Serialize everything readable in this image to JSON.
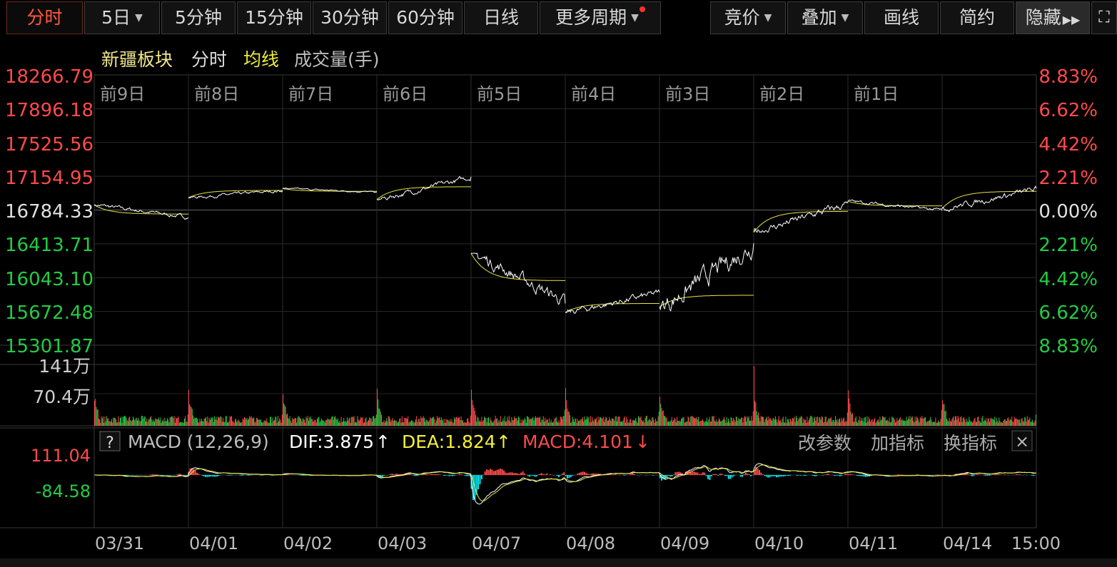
{
  "toolbar": {
    "tabs": [
      "分时",
      "5日",
      "5分钟",
      "15分钟",
      "30分钟",
      "60分钟",
      "日线",
      "更多周期"
    ],
    "tools": [
      "竞价",
      "叠加",
      "画线",
      "简约",
      "隐藏"
    ],
    "active_tab": "分时"
  },
  "legend": {
    "name": "新疆板块",
    "mode": "分时",
    "avg": "均线",
    "volume": "成交量(手)"
  },
  "price_axis": {
    "left": [
      "18266.79",
      "17896.18",
      "17525.56",
      "17154.95",
      "16784.33",
      "16413.71",
      "16043.10",
      "15672.48",
      "15301.87"
    ],
    "right": [
      "8.83%",
      "6.62%",
      "4.42%",
      "2.21%",
      "0.00%",
      "2.21%",
      "4.42%",
      "6.62%",
      "8.83%"
    ]
  },
  "day_labels": [
    "前9日",
    "前8日",
    "前7日",
    "前6日",
    "前5日",
    "前4日",
    "前3日",
    "前2日",
    "前1日"
  ],
  "volume_axis": [
    "141万",
    "70.4万"
  ],
  "macd": {
    "help": "?",
    "title": "MACD (12,26,9)",
    "dif": "DIF:3.875",
    "dif_arrow": "↑",
    "dea": "DEA:1.824",
    "dea_arrow": "↑",
    "macd": "MACD:4.101",
    "macd_arrow": "↓",
    "axis": [
      "111.04",
      "-84.58"
    ],
    "buttons": [
      "改参数",
      "加指标",
      "换指标"
    ],
    "close": "×"
  },
  "date_labels": [
    "03/31",
    "04/01",
    "04/02",
    "04/03",
    "04/07",
    "04/08",
    "04/09",
    "04/10",
    "04/11",
    "04/14",
    "15:00"
  ],
  "colors": {
    "up": "#ff4a4a",
    "down": "#22cc44",
    "price_line": "#ffffff",
    "avg_line": "#e6e645",
    "macd_down": "#00e5ee",
    "grid": "#333333"
  },
  "chart_data": {
    "type": "line",
    "title": "新疆板块",
    "base": 16784.33,
    "ylim": [
      15301.87,
      18266.79
    ],
    "days": [
      {
        "label": "03/31",
        "open": 16840,
        "close": 16700,
        "min": 16630,
        "max": 16860,
        "avg": 16740
      },
      {
        "label": "04/01",
        "open": 16920,
        "close": 17000,
        "min": 16900,
        "max": 17080,
        "avg": 17000
      },
      {
        "label": "04/02",
        "open": 17020,
        "close": 16980,
        "min": 16950,
        "max": 17040,
        "avg": 16990
      },
      {
        "label": "04/03",
        "open": 16900,
        "close": 17150,
        "min": 16880,
        "max": 17190,
        "avg": 17040
      },
      {
        "label": "04/07",
        "open": 16310,
        "close": 15760,
        "min": 15560,
        "max": 16310,
        "avg": 16010
      },
      {
        "label": "04/08",
        "open": 15660,
        "close": 15880,
        "min": 15540,
        "max": 15960,
        "avg": 15760
      },
      {
        "label": "04/09",
        "open": 15720,
        "close": 16420,
        "min": 15340,
        "max": 16480,
        "avg": 15850
      },
      {
        "label": "04/10",
        "open": 16540,
        "close": 16860,
        "min": 16540,
        "max": 17000,
        "avg": 16770
      },
      {
        "label": "04/11",
        "open": 16880,
        "close": 16780,
        "min": 16740,
        "max": 16930,
        "avg": 16830
      },
      {
        "label": "04/14",
        "open": 16800,
        "close": 17020,
        "min": 16760,
        "max": 17110,
        "avg": 16990
      }
    ]
  }
}
